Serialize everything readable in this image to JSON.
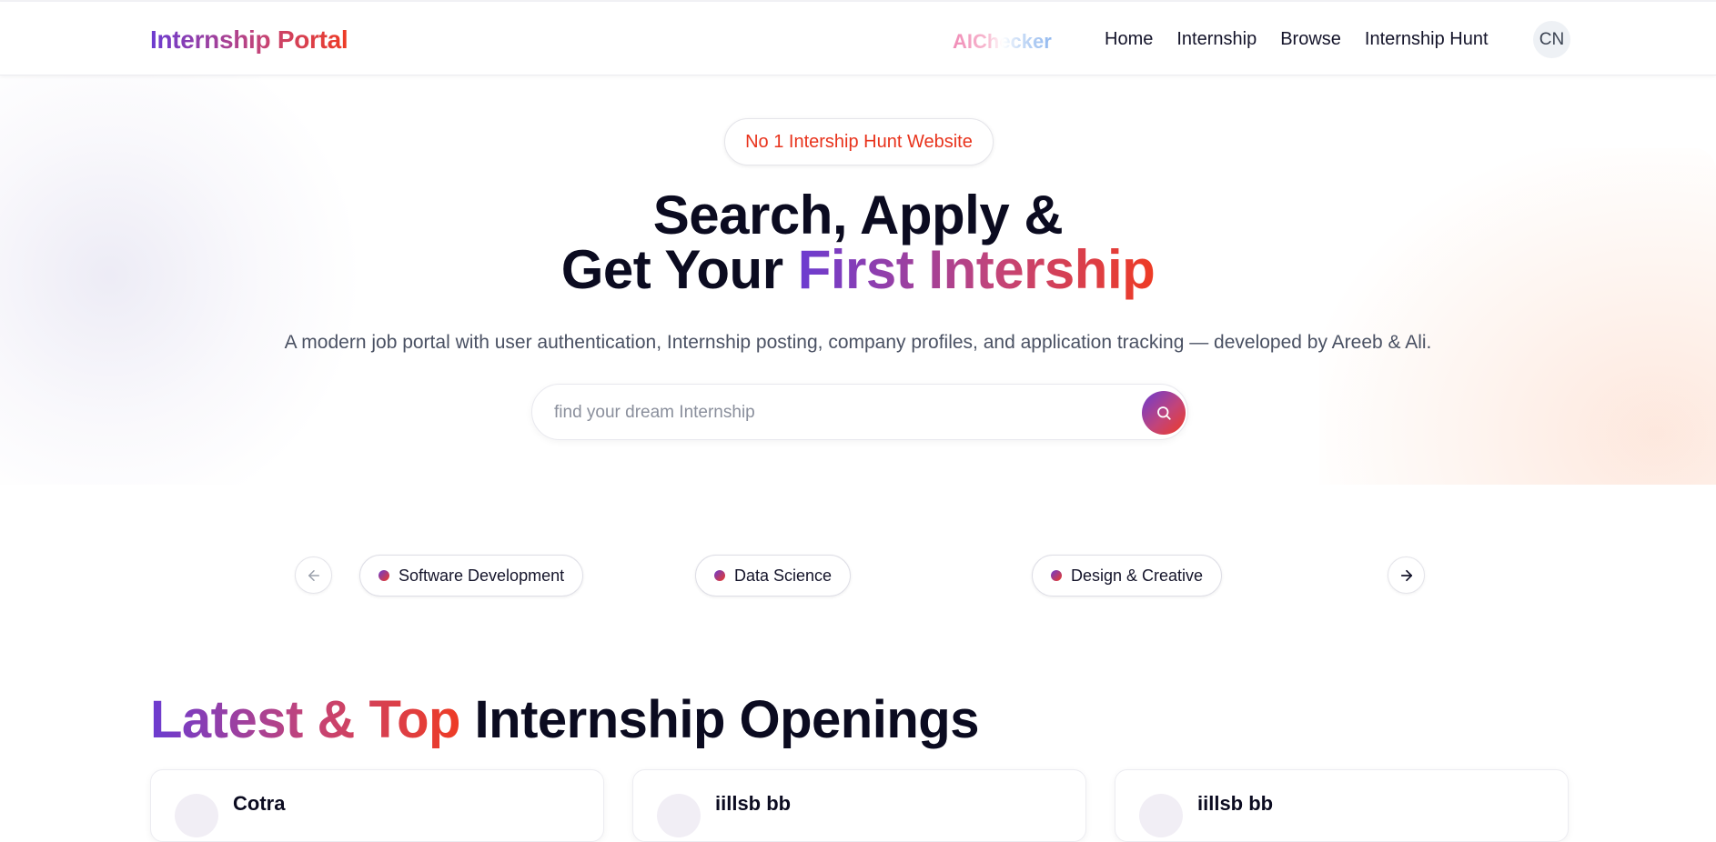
{
  "navbar": {
    "logo": "Internship Portal",
    "aichecker": "AIChecker",
    "links": [
      "Home",
      "Internship",
      "Browse",
      "Internship Hunt"
    ],
    "avatar_initials": "CN"
  },
  "hero": {
    "badge": "No 1 Intership Hunt Website",
    "headline_line1": "Search, Apply &",
    "headline_line2_plain": "Get Your ",
    "headline_line2_gradient": "First Intership",
    "subtitle": "A modern job portal with user authentication, Internship posting, company profiles, and application tracking — developed by Areeb & Ali.",
    "search_placeholder": "find your dream Internship"
  },
  "categories": {
    "items": [
      "Software Development",
      "Data Science",
      "Design & Creative"
    ]
  },
  "latest": {
    "title_gradient": "Latest & Top",
    "title_plain": " Internship Openings",
    "cards": [
      {
        "company": "Cotra"
      },
      {
        "company": "iillsb bb"
      },
      {
        "company": "iillsb bb"
      }
    ]
  },
  "colors": {
    "brand_purple": "#6b3bd1",
    "brand_pink": "#c2447a",
    "brand_red": "#ee3b24",
    "badge_text": "#e8331c"
  }
}
